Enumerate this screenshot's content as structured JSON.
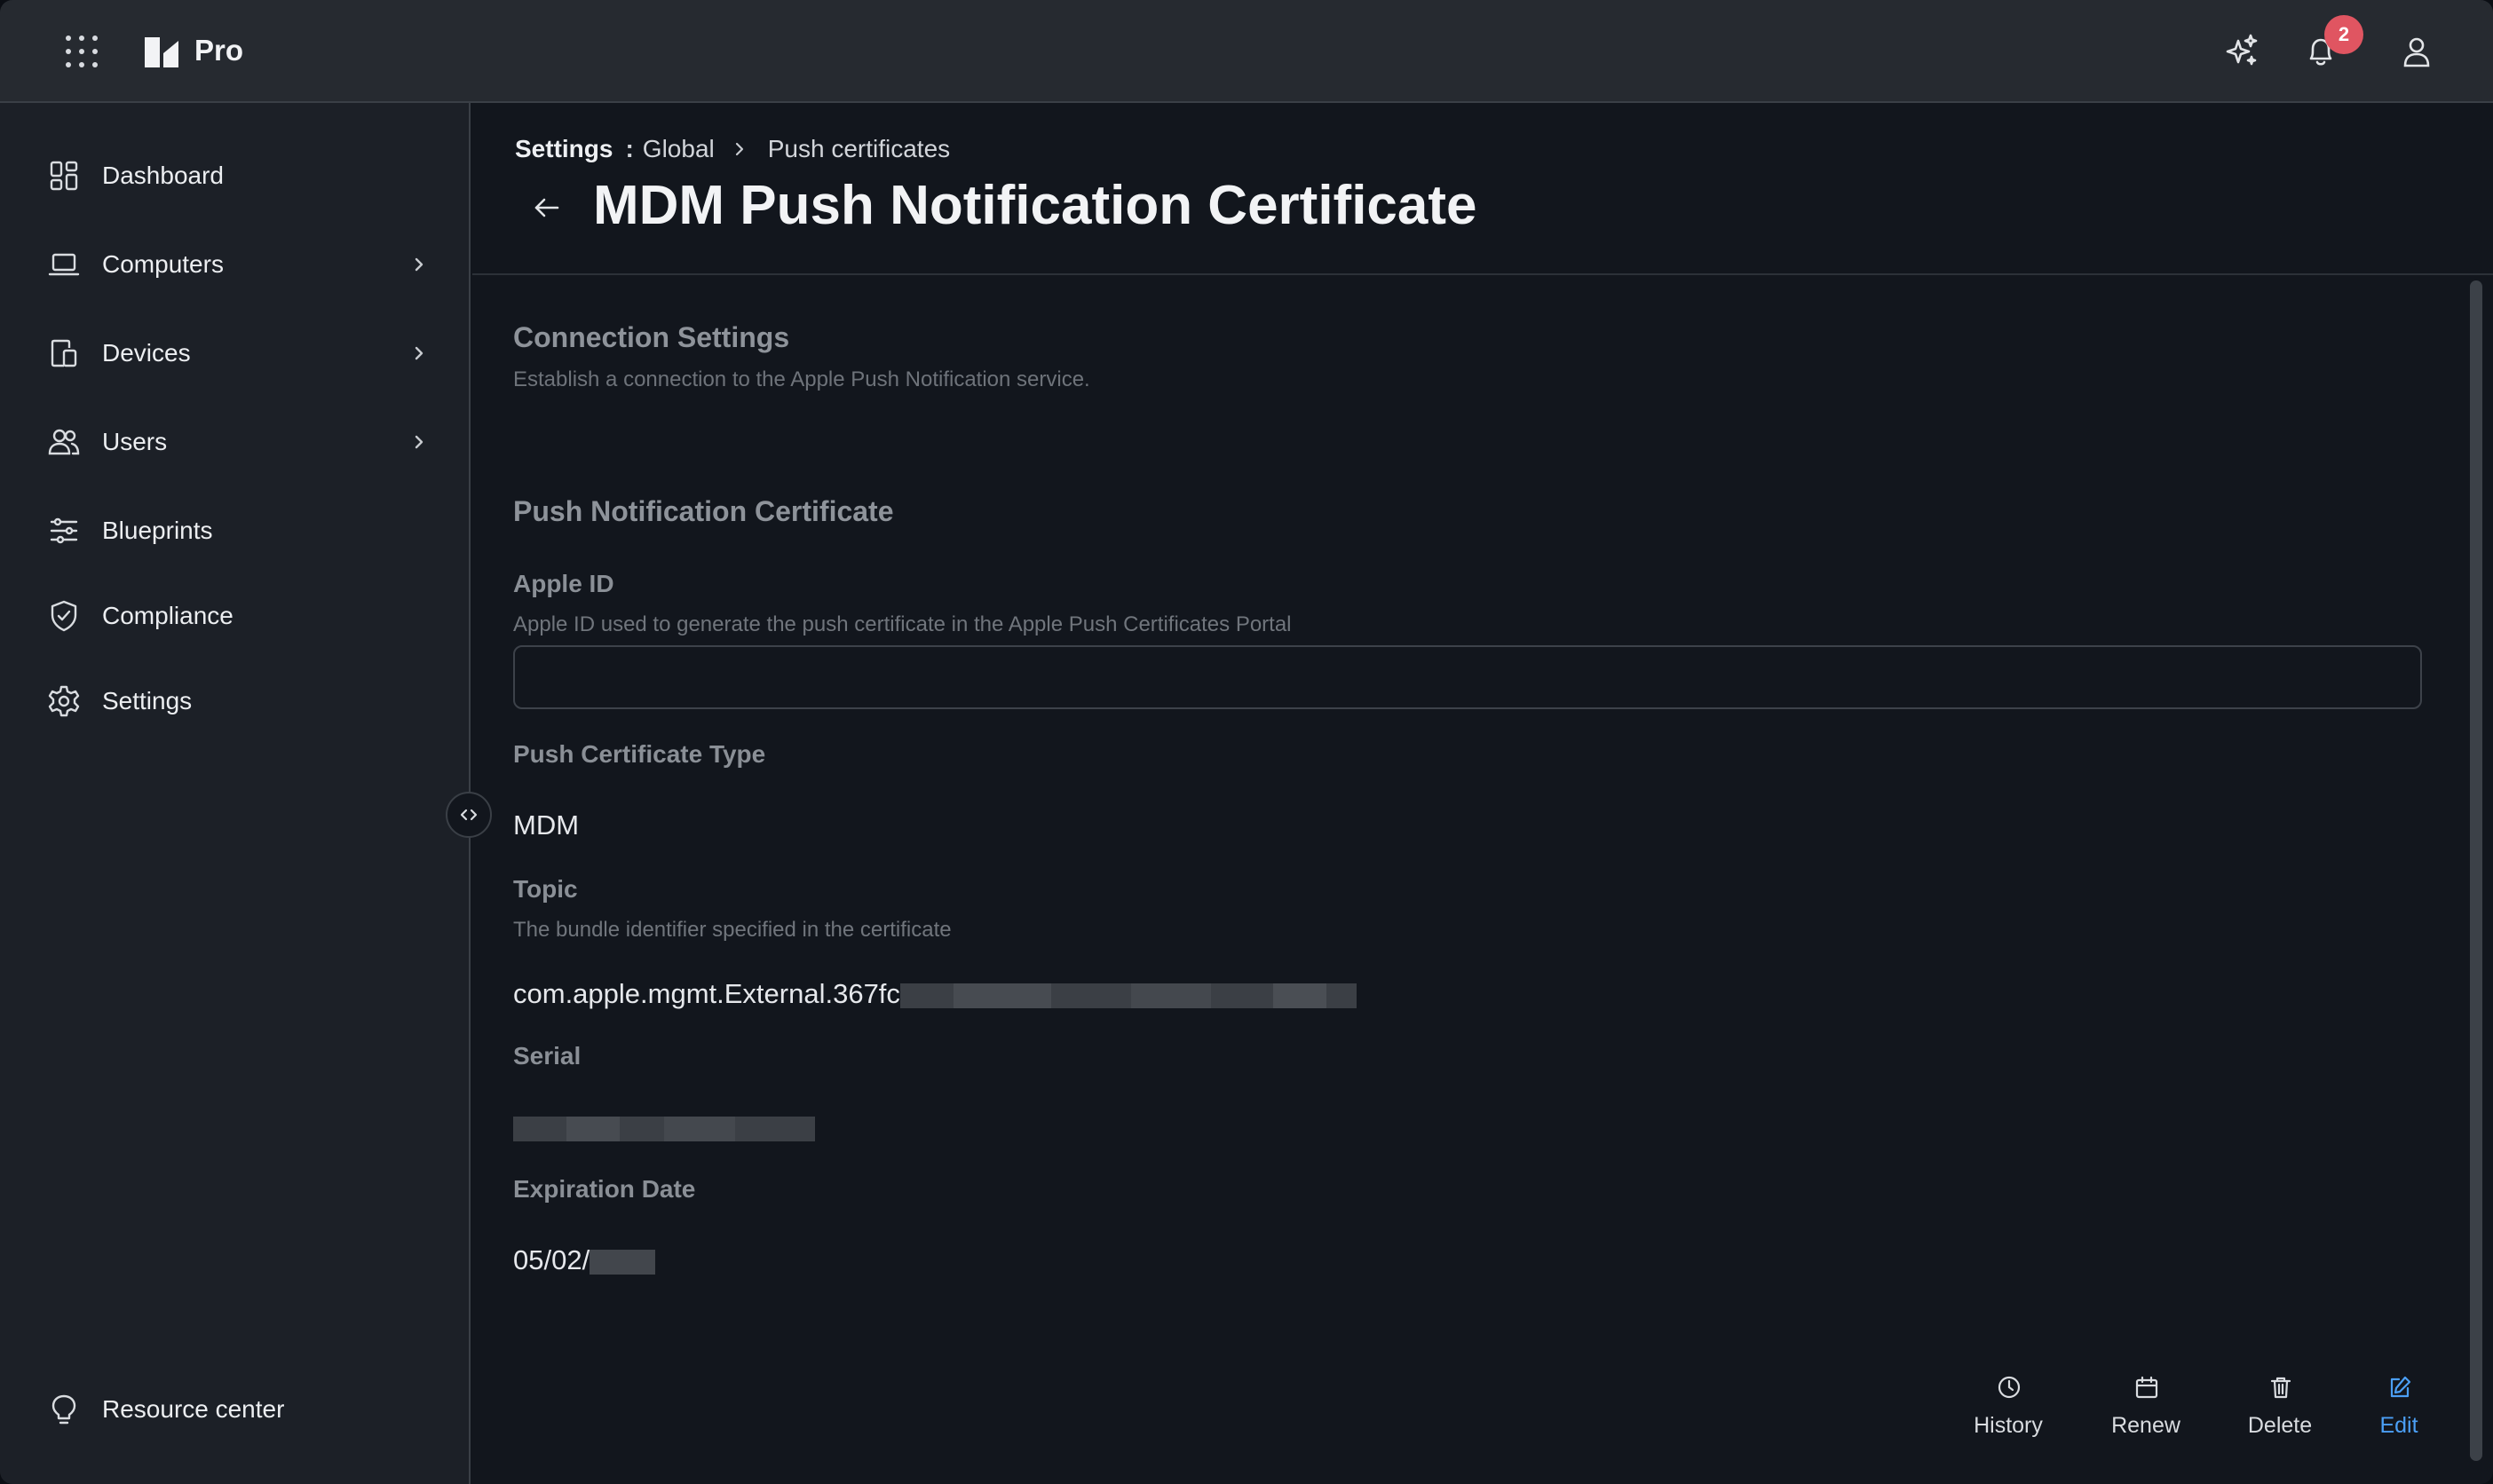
{
  "topbar": {
    "brand": "Pro",
    "notification_count": "2"
  },
  "sidebar": {
    "items": [
      {
        "label": "Dashboard",
        "icon": "dashboard-icon"
      },
      {
        "label": "Computers",
        "icon": "laptop-icon",
        "expandable": true
      },
      {
        "label": "Devices",
        "icon": "devices-icon",
        "expandable": true
      },
      {
        "label": "Users",
        "icon": "users-icon",
        "expandable": true
      },
      {
        "label": "Blueprints",
        "icon": "sliders-icon"
      },
      {
        "label": "Compliance",
        "icon": "shield-icon"
      },
      {
        "label": "Settings",
        "icon": "gear-icon"
      }
    ],
    "footer_item": {
      "label": "Resource center",
      "icon": "lightbulb-icon"
    }
  },
  "breadcrumb": {
    "root": "Settings",
    "separator": ":",
    "level1": "Global",
    "level2": "Push certificates"
  },
  "page": {
    "title": "MDM Push Notification Certificate"
  },
  "connection": {
    "title": "Connection Settings",
    "description": "Establish a connection to the Apple Push Notification service."
  },
  "certificate": {
    "title": "Push Notification Certificate",
    "apple_id": {
      "label": "Apple ID",
      "description": "Apple ID used to generate the push certificate in the Apple Push Certificates Portal",
      "value": ""
    },
    "type": {
      "label": "Push Certificate Type",
      "value": "MDM"
    },
    "topic": {
      "label": "Topic",
      "description": "The bundle identifier specified in the certificate",
      "value": "com.apple.mgmt.External.367fc"
    },
    "serial": {
      "label": "Serial"
    },
    "expiration": {
      "label": "Expiration Date",
      "value": "05/02/"
    }
  },
  "actions": {
    "history": "History",
    "renew": "Renew",
    "delete": "Delete",
    "edit": "Edit"
  },
  "colors": {
    "accent": "#4b9ff5",
    "badge": "#e05561",
    "background": "#12161d",
    "sidebar": "#1c2027",
    "topbar": "#262a30"
  }
}
